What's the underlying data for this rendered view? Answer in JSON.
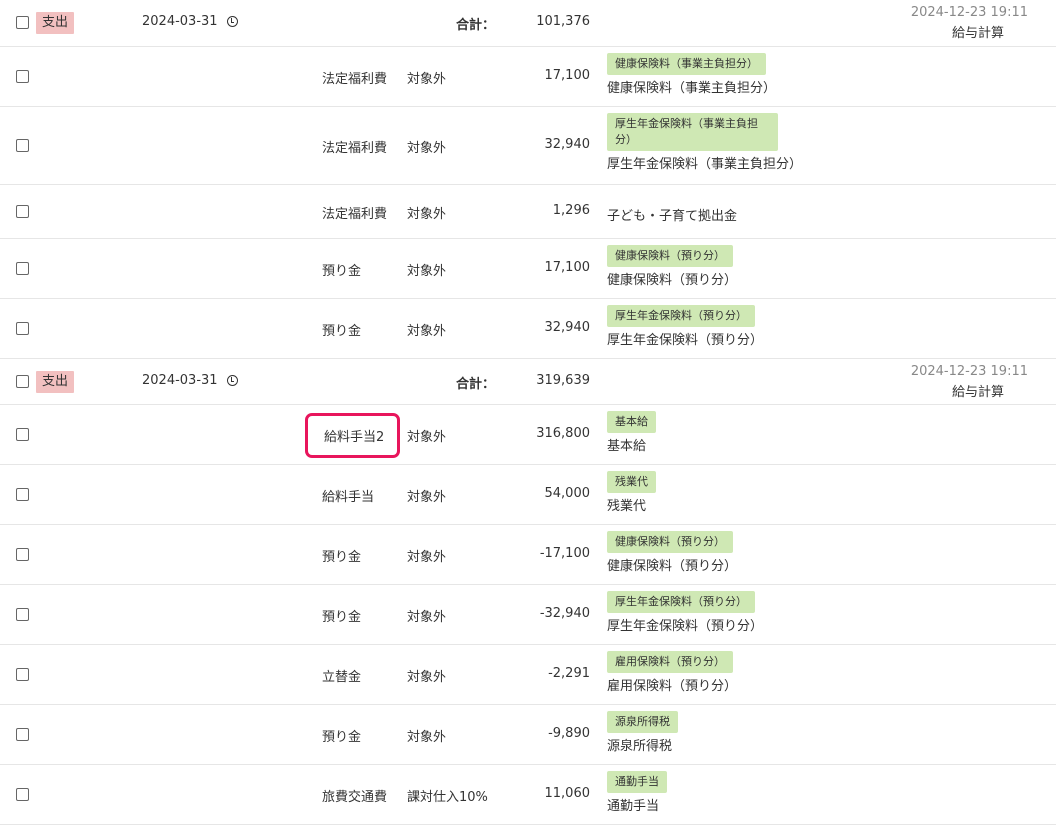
{
  "groups": [
    {
      "kind": "支出",
      "date": "2024-03-31",
      "total_label": "合計：",
      "total": "101,376",
      "timestamp": "2024-12-23 19:11",
      "source": "給与計算",
      "rows": [
        {
          "account": "法定福利費",
          "tax": "対象外",
          "amount": "17,100",
          "tag": "健康保険料（事業主負担分）",
          "memo": "健康保険料（事業主負担分）"
        },
        {
          "account": "法定福利費",
          "tax": "対象外",
          "amount": "32,940",
          "tag": "厚生年金保険料（事業主負担分）",
          "memo": "厚生年金保険料（事業主負担分）"
        },
        {
          "account": "法定福利費",
          "tax": "対象外",
          "amount": "1,296",
          "tag": "",
          "memo": "子ども・子育て拠出金"
        },
        {
          "account": "預り金",
          "tax": "対象外",
          "amount": "17,100",
          "tag": "健康保険料（預り分）",
          "memo": "健康保険料（預り分）"
        },
        {
          "account": "預り金",
          "tax": "対象外",
          "amount": "32,940",
          "tag": "厚生年金保険料（預り分）",
          "memo": "厚生年金保険料（預り分）"
        }
      ]
    },
    {
      "kind": "支出",
      "date": "2024-03-31",
      "total_label": "合計：",
      "total": "319,639",
      "timestamp": "2024-12-23 19:11",
      "source": "給与計算",
      "rows": [
        {
          "account": "給料手当2",
          "tax": "対象外",
          "amount": "316,800",
          "tag": "基本給",
          "memo": "基本給"
        },
        {
          "account": "給料手当",
          "tax": "対象外",
          "amount": "54,000",
          "tag": "残業代",
          "memo": "残業代"
        },
        {
          "account": "預り金",
          "tax": "対象外",
          "amount": "-17,100",
          "tag": "健康保険料（預り分）",
          "memo": "健康保険料（預り分）"
        },
        {
          "account": "預り金",
          "tax": "対象外",
          "amount": "-32,940",
          "tag": "厚生年金保険料（預り分）",
          "memo": "厚生年金保険料（預り分）"
        },
        {
          "account": "立替金",
          "tax": "対象外",
          "amount": "-2,291",
          "tag": "雇用保険料（預り分）",
          "memo": "雇用保険料（預り分）"
        },
        {
          "account": "預り金",
          "tax": "対象外",
          "amount": "-9,890",
          "tag": "源泉所得税",
          "memo": "源泉所得税"
        },
        {
          "account": "旅費交通費",
          "tax": "課対仕入10%",
          "amount": "11,060",
          "tag": "通勤手当",
          "memo": "通勤手当"
        }
      ]
    }
  ],
  "colors": {
    "expense_badge": "#f2c0c0",
    "tag_bg": "#cfe8b4",
    "highlight": "#e8155c"
  }
}
